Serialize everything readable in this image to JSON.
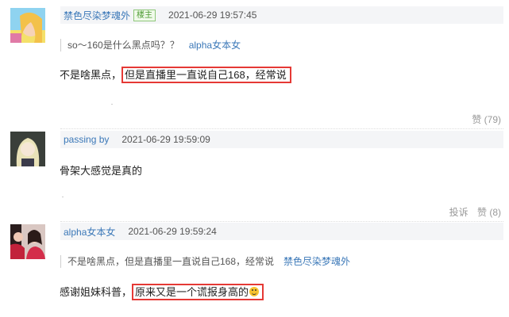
{
  "comments": [
    {
      "user": "禁色尽染梦魂外",
      "badge": "楼主",
      "time": "2021-06-29 19:57:45",
      "quote_text": "so～160是什么黑点吗？？",
      "quote_user": "alpha女本女",
      "content_plain": "不是啥黑点，",
      "content_highlight": "但是直播里一直说自己168，经常说",
      "likes": "赞 (79)"
    },
    {
      "user": "passing by",
      "time": "2021-06-29 19:59:09",
      "content_plain": "骨架大感觉是真的",
      "report": "投诉",
      "likes": "赞 (8)"
    },
    {
      "user": "alpha女本女",
      "time": "2021-06-29 19:59:24",
      "quote_text": "不是啥黑点，但是直播里一直说自己168，经常说",
      "quote_user": "禁色尽染梦魂外",
      "content_plain": "感谢姐妹科普，",
      "content_highlight": "原来又是一个谎报身高的",
      "emoji": "grinning-face-icon"
    }
  ]
}
